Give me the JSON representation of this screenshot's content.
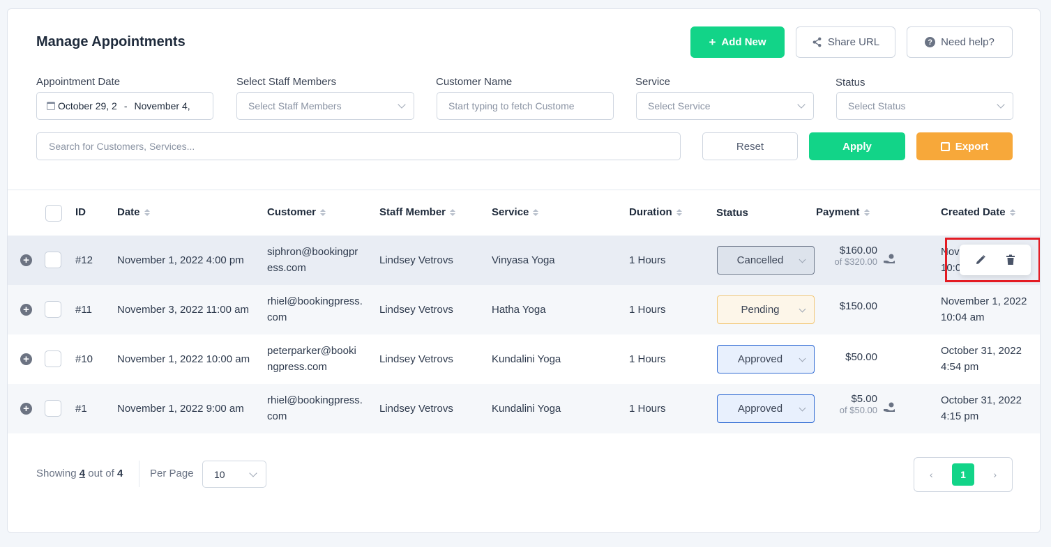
{
  "header": {
    "title": "Manage Appointments",
    "add_new_label": "Add New",
    "share_url_label": "Share URL",
    "need_help_label": "Need help?"
  },
  "filters": {
    "date_label": "Appointment Date",
    "date_start": "October 29, 2",
    "date_sep": "-",
    "date_end": "November 4,",
    "staff_label": "Select Staff Members",
    "staff_placeholder": "Select Staff Members",
    "customer_label": "Customer Name",
    "customer_placeholder": "Start typing to fetch Custome",
    "service_label": "Service",
    "service_placeholder": "Select Service",
    "status_label": "Status",
    "status_placeholder": "Select Status",
    "search_placeholder": "Search for Customers, Services...",
    "reset_label": "Reset",
    "apply_label": "Apply",
    "export_label": "Export"
  },
  "table": {
    "columns": {
      "id": "ID",
      "date": "Date",
      "customer": "Customer",
      "staff": "Staff Member",
      "service": "Service",
      "duration": "Duration",
      "status": "Status",
      "payment": "Payment",
      "created": "Created Date"
    },
    "rows": [
      {
        "id": "#12",
        "date": "November 1, 2022 4:00 pm",
        "customer_l1": "siphron@bookingpr",
        "customer_l2": "ess.com",
        "staff": "Lindsey Vetrovs",
        "service": "Vinyasa Yoga",
        "duration": "1 Hours",
        "status": "Cancelled",
        "payment": "$160.00",
        "payment_of": "of $320.00",
        "created_l1": "Nov",
        "created_l2": "10:0"
      },
      {
        "id": "#11",
        "date": "November 3, 2022 11:00 am",
        "customer_l1": "rhiel@bookingpress.",
        "customer_l2": "com",
        "staff": "Lindsey Vetrovs",
        "service": "Hatha Yoga",
        "duration": "1 Hours",
        "status": "Pending",
        "payment": "$150.00",
        "payment_of": "",
        "created_l1": "November 1, 2022",
        "created_l2": "10:04 am"
      },
      {
        "id": "#10",
        "date": "November 1, 2022 10:00 am",
        "customer_l1": "peterparker@booki",
        "customer_l2": "ngpress.com",
        "staff": "Lindsey Vetrovs",
        "service": "Kundalini Yoga",
        "duration": "1 Hours",
        "status": "Approved",
        "payment": "$50.00",
        "payment_of": "",
        "created_l1": "October 31, 2022",
        "created_l2": "4:54 pm"
      },
      {
        "id": "#1",
        "date": "November 1, 2022 9:00 am",
        "customer_l1": "rhiel@bookingpress.",
        "customer_l2": "com",
        "staff": "Lindsey Vetrovs",
        "service": "Kundalini Yoga",
        "duration": "1 Hours",
        "status": "Approved",
        "payment": "$5.00",
        "payment_of": "of $50.00",
        "created_l1": "October 31, 2022",
        "created_l2": "4:15 pm"
      }
    ]
  },
  "footer": {
    "showing_prefix": "Showing",
    "showing_count": "4",
    "showing_mid": "out of",
    "showing_total": "4",
    "per_page_label": "Per Page",
    "per_page_value": "10",
    "current_page": "1",
    "prev_symbol": "‹",
    "next_symbol": "›"
  },
  "colors": {
    "primary": "#12d488",
    "export": "#f7a83a",
    "highlight": "#e31b23"
  }
}
